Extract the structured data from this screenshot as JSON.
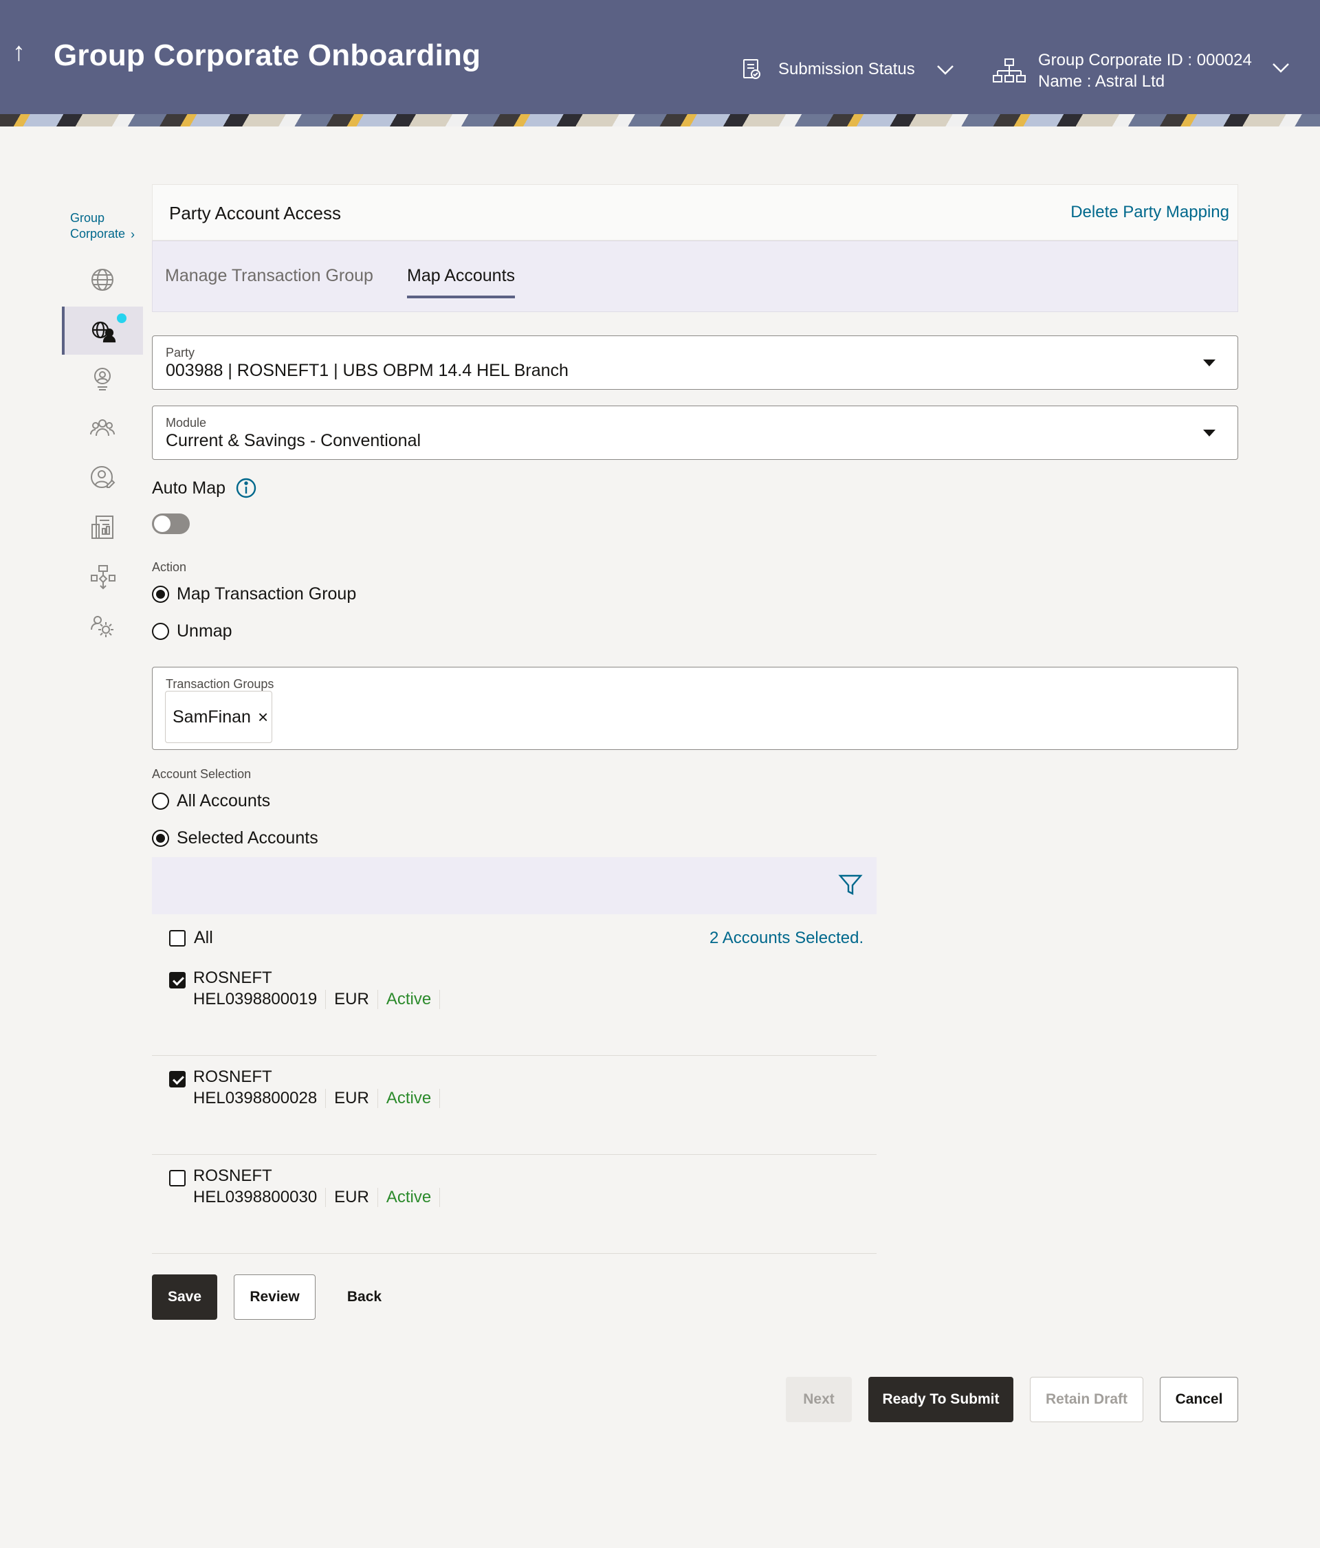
{
  "header": {
    "title": "Group Corporate Onboarding",
    "submission_status": "Submission Status",
    "gc_id": "Group Corporate ID : 000024",
    "gc_name": "Name : Astral Ltd"
  },
  "rail": {
    "heading_line1": "Group",
    "heading_line2": "Corporate",
    "items": [
      "globe-icon",
      "party-account-icon",
      "user-badge-icon",
      "users-group-icon",
      "user-edit-icon",
      "report-icon",
      "workflow-icon",
      "settings-users-icon"
    ]
  },
  "card": {
    "title": "Party Account Access",
    "delete_link": "Delete Party Mapping",
    "tabs": [
      "Manage Transaction Group",
      "Map Accounts"
    ]
  },
  "party": {
    "label": "Party",
    "value": "003988 | ROSNEFT1 | UBS OBPM 14.4 HEL Branch"
  },
  "module": {
    "label": "Module",
    "value": "Current & Savings - Conventional"
  },
  "auto_map": {
    "label": "Auto Map",
    "enabled": false
  },
  "action": {
    "label": "Action",
    "options": [
      "Map Transaction Group",
      "Unmap"
    ],
    "selected": "Map Transaction Group"
  },
  "transaction_groups": {
    "label": "Transaction Groups",
    "chips": [
      "SamFinan"
    ]
  },
  "account_selection": {
    "label": "Account Selection",
    "options": [
      "All Accounts",
      "Selected Accounts"
    ],
    "selected": "Selected Accounts"
  },
  "accounts": {
    "all_label": "All",
    "selected_count": "2 Accounts Selected.",
    "rows": [
      {
        "name": "ROSNEFT",
        "number": "HEL0398800019",
        "currency": "EUR",
        "status": "Active",
        "checked": true
      },
      {
        "name": "ROSNEFT",
        "number": "HEL0398800028",
        "currency": "EUR",
        "status": "Active",
        "checked": true
      },
      {
        "name": "ROSNEFT",
        "number": "HEL0398800030",
        "currency": "EUR",
        "status": "Active",
        "checked": false
      }
    ]
  },
  "form_buttons": {
    "save": "Save",
    "review": "Review",
    "back": "Back"
  },
  "footer_buttons": {
    "next": "Next",
    "ready": "Ready To Submit",
    "retain": "Retain Draft",
    "cancel": "Cancel"
  },
  "colors": {
    "header": "#5b6184",
    "link": "#00688c",
    "active_status": "#2b8a2b",
    "notify_dot": "#26d3ee"
  }
}
